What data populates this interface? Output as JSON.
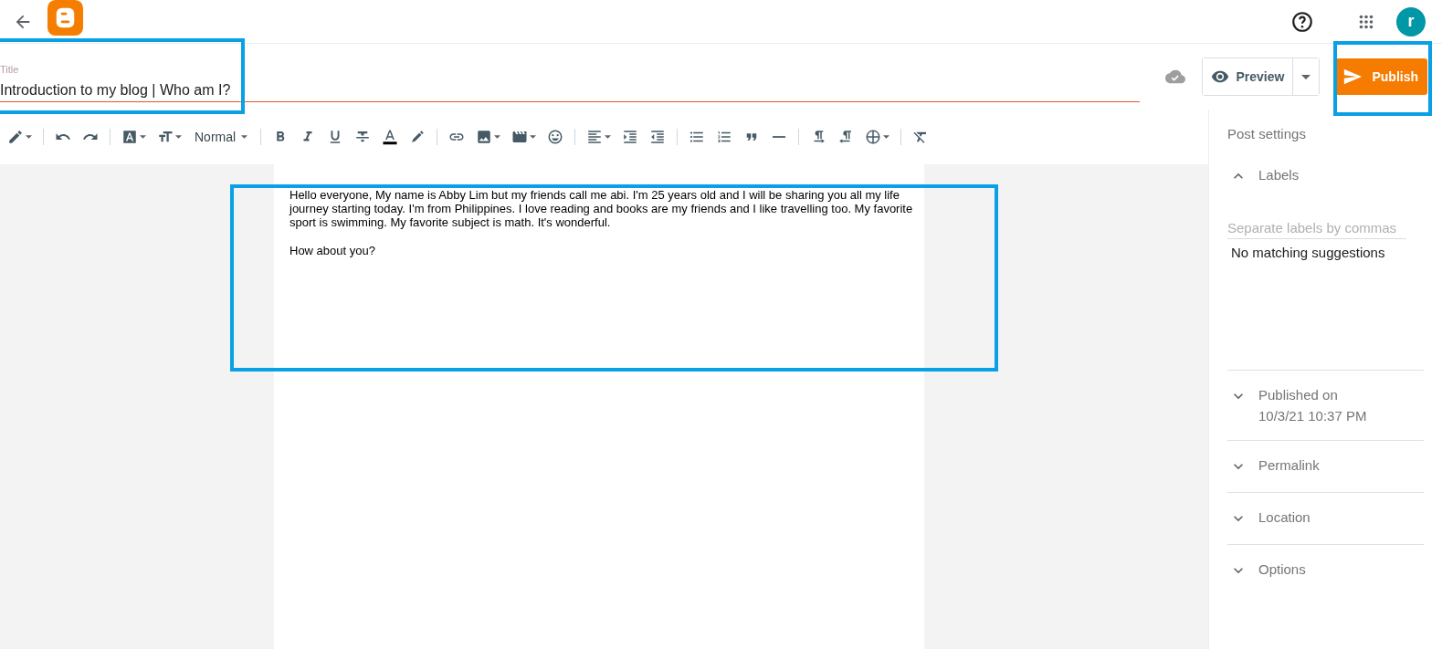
{
  "header": {
    "avatar_letter": "r"
  },
  "title_field": {
    "label": "Title",
    "value": "Introduction to my blog | Who am I?"
  },
  "actions": {
    "preview": "Preview",
    "publish": "Publish"
  },
  "toolbar": {
    "paragraph_style": "Normal"
  },
  "post_body": {
    "paragraphs": [
      " Hello everyone, My name is Abby Lim but my friends call me abi. I'm 25 years old and I will be sharing you all my life journey starting today. I'm from Philippines. I love reading and books are my friends and I like travelling too. My favorite sport is swimming. My favorite subject is math. It's wonderful.",
      "How about you?"
    ]
  },
  "sidebar": {
    "title": "Post settings",
    "sections": [
      {
        "label": "Labels",
        "expanded": true
      },
      {
        "label": "Published on",
        "detail": "10/3/21 10:37 PM",
        "expanded": false
      },
      {
        "label": "Permalink",
        "expanded": false
      },
      {
        "label": "Location",
        "expanded": false
      },
      {
        "label": "Options",
        "expanded": false
      }
    ],
    "labels_field": {
      "placeholder": "Separate labels by commas"
    },
    "suggestions_note": "No matching suggestions"
  }
}
